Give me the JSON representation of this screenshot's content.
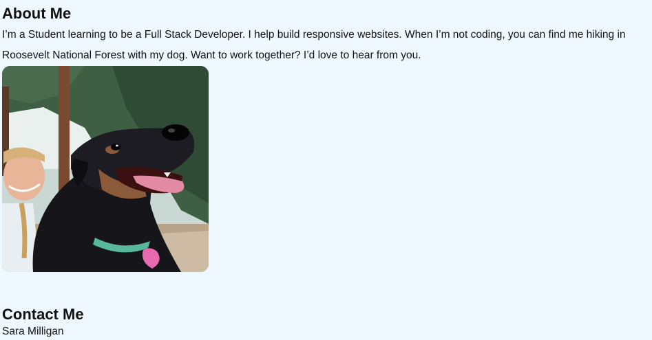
{
  "about": {
    "heading": "About Me",
    "text": "I’m a Student learning to be a Full Stack Developer. I help build responsive websites. When I’m not coding, you can find me hiking in Roosevelt National Forest with my dog. Want to work together? I’d love to hear from you."
  },
  "photo": {
    "icon": "dog-photo-image"
  },
  "contact": {
    "heading": "Contact Me",
    "name": "Sara Milligan"
  }
}
